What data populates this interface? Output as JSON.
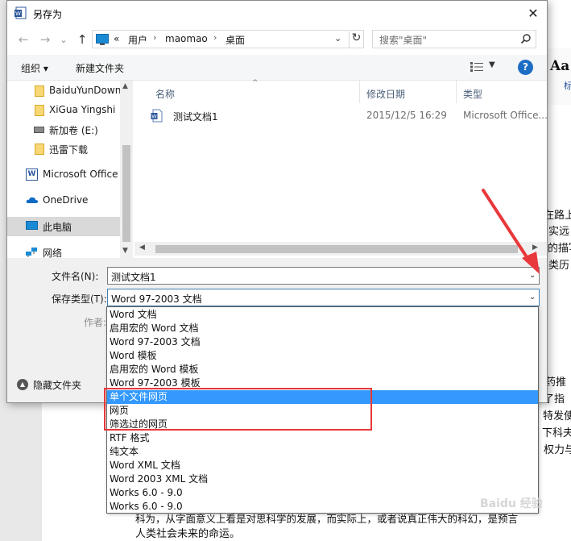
{
  "dialog": {
    "title": "另存为",
    "close_glyph": "✕"
  },
  "address": {
    "back": "←",
    "forward": "→",
    "recent": "⌄",
    "up": "↑",
    "prefix": "«",
    "crumbs": [
      "用户",
      "maomao",
      "桌面"
    ],
    "separator": "›",
    "dropdown": "⌄",
    "refresh": "↻"
  },
  "search": {
    "placeholder": "搜索\"桌面\""
  },
  "toolbar": {
    "organize": "组织 ▾",
    "new_folder": "新建文件夹",
    "view_drop": "▼",
    "help": "?"
  },
  "nav": {
    "items": [
      {
        "label": "BaiduYunDown",
        "icon": "folder-icon"
      },
      {
        "label": "XiGua Yingshi",
        "icon": "folder-icon"
      },
      {
        "label": "新加卷 (E:)",
        "icon": "drive-icon"
      },
      {
        "label": "迅雷下载",
        "icon": "folder-icon"
      },
      {
        "label": "Microsoft Office",
        "icon": "office-icon"
      },
      {
        "label": "OneDrive",
        "icon": "cloud-icon"
      },
      {
        "label": "此电脑",
        "icon": "pc-icon"
      },
      {
        "label": "网络",
        "icon": "network-icon"
      }
    ],
    "office_glyph": "W",
    "scroll_up": "▲",
    "scroll_down": "▼"
  },
  "files": {
    "columns": {
      "name": "名称",
      "modified": "修改日期",
      "type": "类型"
    },
    "sort_caret": "^",
    "rows": [
      {
        "name": "测试文档1",
        "modified": "2015/12/5 16:29",
        "type": "Microsoft Office..."
      }
    ],
    "scroll_left": "◀",
    "scroll_right": "▶"
  },
  "form": {
    "filename_label": "文件名(N):",
    "filename_value": "测试文档1",
    "filetype_label": "保存类型(T):",
    "filetype_value": "Word 97-2003 文档",
    "dropdown_glyph": "⌄",
    "author_label": "作者:",
    "hide_folders": "隐藏文件夹",
    "hide_glyph": "▲"
  },
  "type_options": [
    "Word 文档",
    "启用宏的 Word 文档",
    "Word 97-2003 文档",
    "Word 模板",
    "启用宏的 Word 模板",
    "Word 97-2003 模板",
    "单个文件网页",
    "网页",
    "筛选过的网页",
    "RTF 格式",
    "纯文本",
    "Word XML 文档",
    "Word 2003 XML 文档",
    "Works 6.0 - 9.0",
    "Works 6.0 - 9.0"
  ],
  "highlighted_option": "单个文件网页",
  "background": {
    "style_sample": "Aa",
    "style_label": "标",
    "lines": [
      "在路上",
      "实远",
      "的描写",
      "类历",
      "药推",
      "了指",
      "特发使",
      "下科夫",
      "权力与"
    ],
    "bottom_line1": "科为，从字面意义上看是对思科学的发展，而实际上，或者说真正伟大的科幻，是预言",
    "bottom_line2": "人类社会未来的命运。",
    "watermark": "Baidu 经验"
  },
  "colors": {
    "highlight": "#3399ff",
    "annotation_red": "#e8383b",
    "accent": "#1c6ec4"
  }
}
